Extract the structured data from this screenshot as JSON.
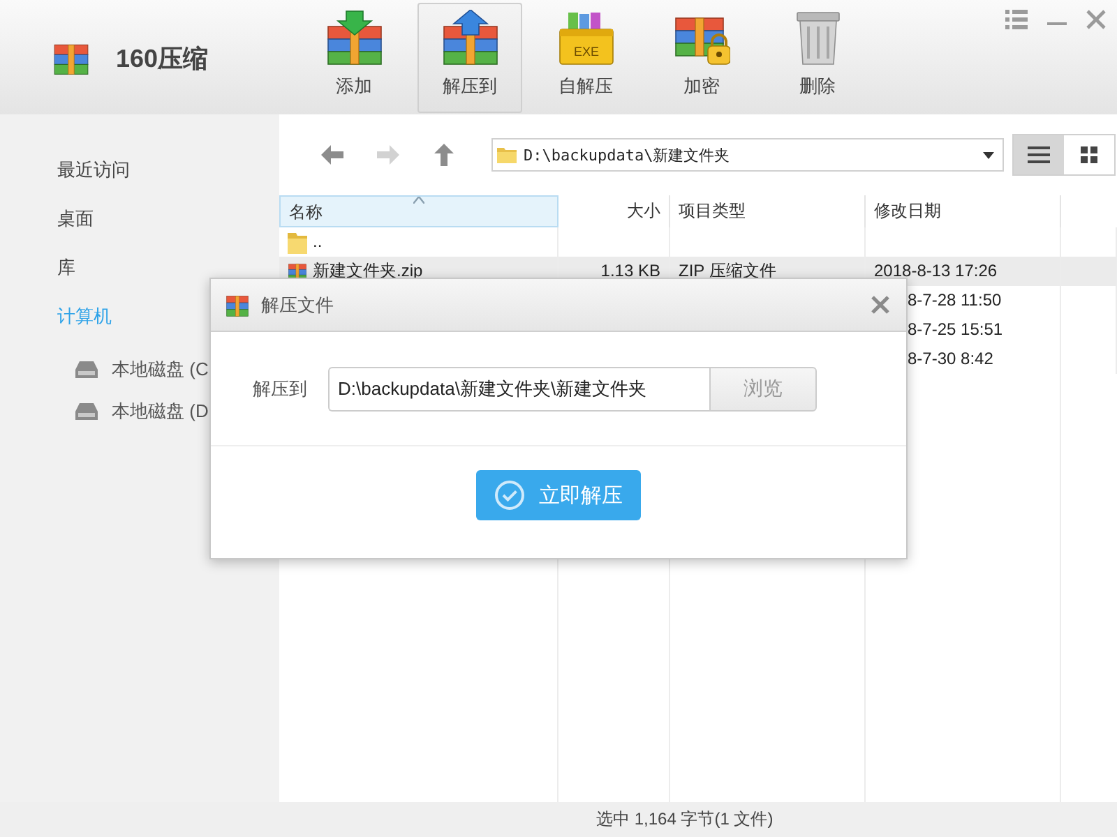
{
  "app": {
    "title": "160压缩"
  },
  "toolbar": [
    {
      "kind": "add",
      "label": "添加",
      "selected": false
    },
    {
      "kind": "extract",
      "label": "解压到",
      "selected": true
    },
    {
      "kind": "sfx",
      "label": "自解压",
      "badge": "EXE",
      "selected": false
    },
    {
      "kind": "encrypt",
      "label": "加密",
      "selected": false
    },
    {
      "kind": "delete",
      "label": "删除",
      "selected": false
    }
  ],
  "sidebar": {
    "items": [
      {
        "label": "最近访问",
        "selected": false
      },
      {
        "label": "桌面",
        "selected": false
      },
      {
        "label": "库",
        "selected": false
      },
      {
        "label": "计算机",
        "selected": true,
        "children": [
          {
            "label": "本地磁盘 (C",
            "selected": false
          },
          {
            "label": "本地磁盘 (D",
            "selected": false
          }
        ]
      }
    ]
  },
  "navigation": {
    "back": {
      "disabled": false
    },
    "forward": {
      "disabled": true
    },
    "path": "D:\\backupdata\\新建文件夹",
    "views": [
      {
        "kind": "list",
        "selected": true
      },
      {
        "kind": "grid",
        "selected": false
      }
    ]
  },
  "table": {
    "columns": [
      {
        "label": "名称",
        "sorted": true
      },
      {
        "label": "大小",
        "sorted": false
      },
      {
        "label": "项目类型",
        "sorted": false
      },
      {
        "label": "修改日期",
        "sorted": false
      }
    ],
    "rows": [
      {
        "kind": "folder",
        "name": "..",
        "selected": false
      },
      {
        "kind": "archive",
        "name": "新建文件夹.zip",
        "size": "1.13 KB",
        "type": "ZIP 压缩文件",
        "modified": "2018-8-13 17:26",
        "selected": true
      },
      {
        "kind": "covered",
        "modified": "8-7-28 11:50",
        "selected": false
      },
      {
        "kind": "covered",
        "modified": "8-7-25 15:51",
        "selected": false
      },
      {
        "kind": "covered",
        "modified": "8-7-30 8:42",
        "selected": false
      }
    ]
  },
  "dialog": {
    "title": "解压文件",
    "label": "解压到",
    "path": "D:\\backupdata\\新建文件夹\\新建文件夹",
    "browse": "浏览",
    "submit": "立即解压"
  },
  "status_bar": {
    "text": "选中 1,164 字节(1 文件)"
  }
}
